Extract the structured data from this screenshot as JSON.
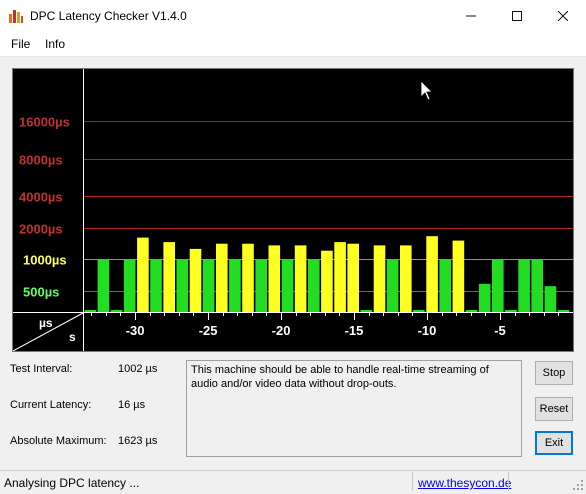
{
  "window": {
    "title": "DPC Latency Checker V1.4.0",
    "minimize_icon": "minimize-icon",
    "maximize_icon": "maximize-icon",
    "close_icon": "close-icon"
  },
  "menu": [
    {
      "label": "File"
    },
    {
      "label": "Info"
    }
  ],
  "chart_data": {
    "type": "bar",
    "y_scale": "log2",
    "y_tick_labels": [
      "16000µs",
      "8000µs",
      "4000µs",
      "2000µs",
      "1000µs",
      "500µs"
    ],
    "y_tick_values": [
      16000,
      8000,
      4000,
      2000,
      1000,
      500
    ],
    "y_tick_colors": [
      "#c03030",
      "#c03030",
      "#c03030",
      "#c03030",
      "#ffff60",
      "#60ff60"
    ],
    "corner_top": "µs",
    "corner_bottom": "s",
    "x_tick_labels": [
      "-30",
      "-25",
      "-20",
      "-15",
      "-10",
      "-5"
    ],
    "x_tick_values": [
      -30,
      -25,
      -20,
      -15,
      -10,
      -5
    ],
    "x_range": [
      -33.5,
      0
    ],
    "values": [
      240,
      1000,
      180,
      1000,
      1600,
      1000,
      1450,
      1000,
      1250,
      1000,
      1400,
      1000,
      1400,
      1000,
      1350,
      1000,
      1350,
      1000,
      1200,
      1450,
      1400,
      180,
      1350,
      1000,
      1350,
      180,
      1650,
      1000,
      1500,
      150,
      580,
      1000,
      230,
      1000,
      1000,
      550,
      150
    ],
    "grid": true
  },
  "info": {
    "test_interval_label": "Test Interval:",
    "test_interval_value": "1002 µs",
    "current_latency_label": "Current Latency:",
    "current_latency_value": "16 µs",
    "absolute_maximum_label": "Absolute Maximum:",
    "absolute_maximum_value": "1623 µs",
    "message": "This machine should be able to handle real-time streaming of audio and/or video data without drop-outs."
  },
  "buttons": {
    "stop": "Stop",
    "reset": "Reset",
    "exit": "Exit"
  },
  "status": {
    "text": "Analysing DPC latency ...",
    "link": "www.thesycon.de"
  }
}
